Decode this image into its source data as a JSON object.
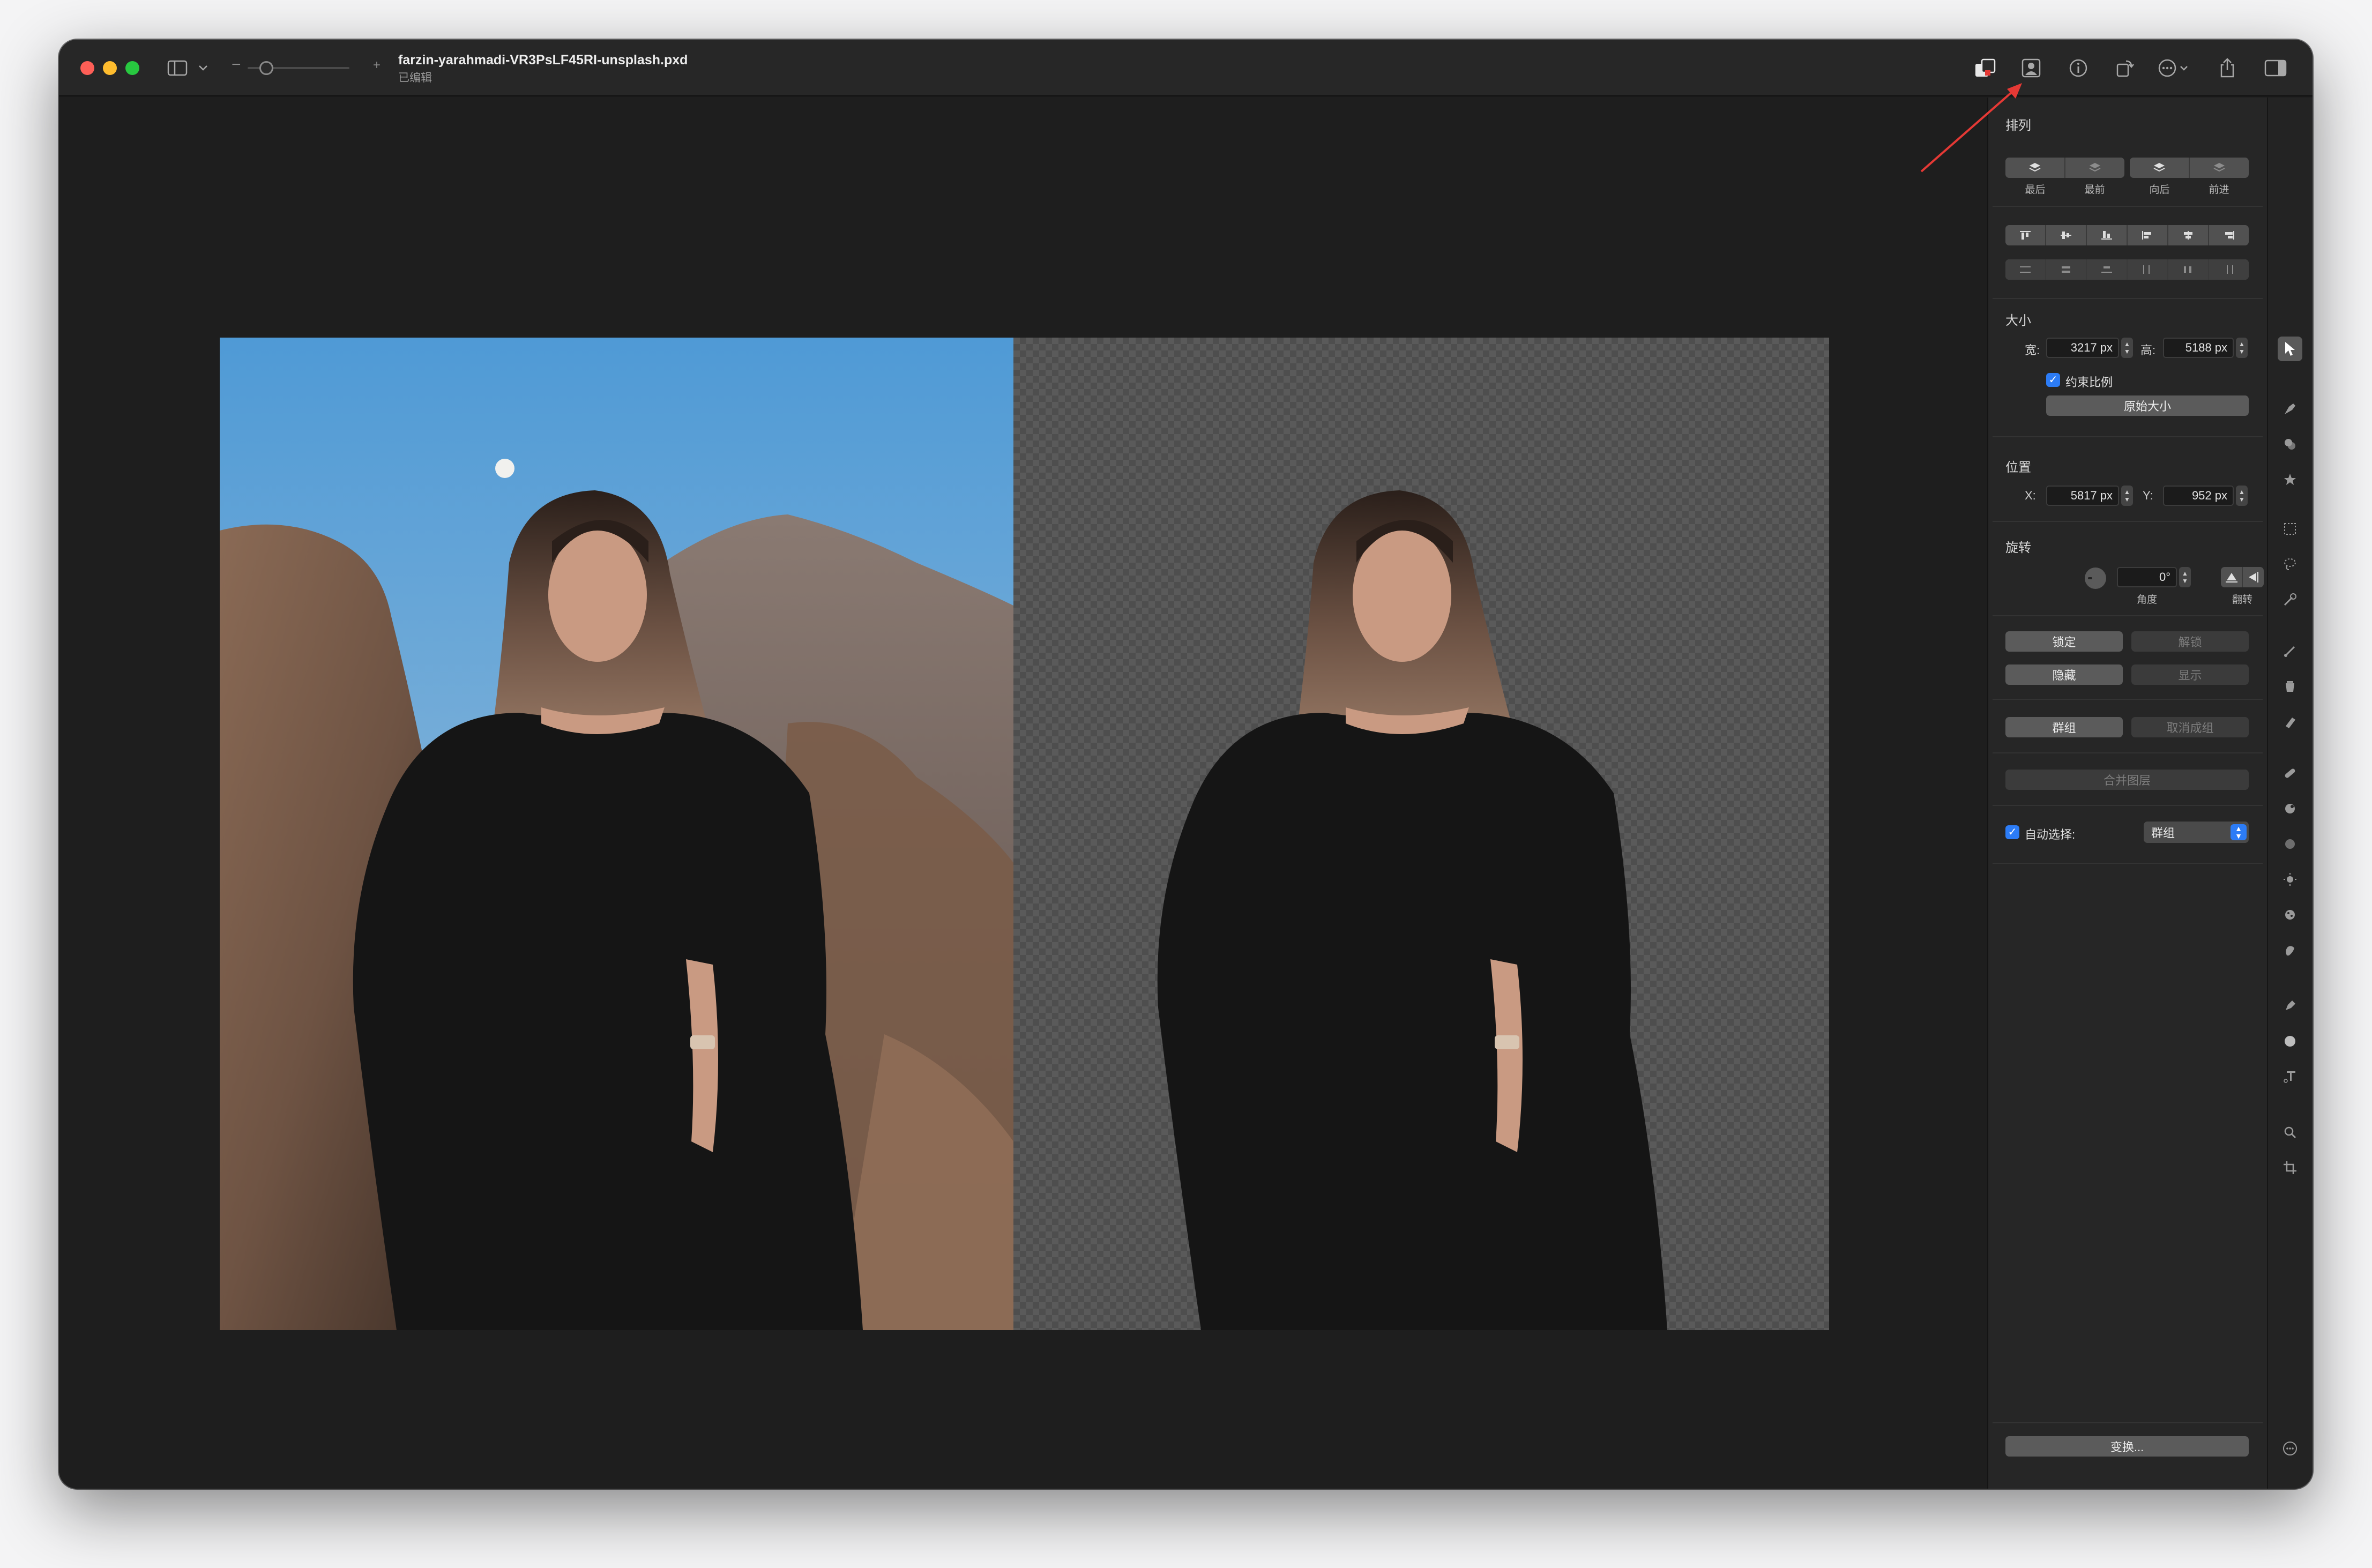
{
  "window": {
    "document_title": "farzin-yarahmadi-VR3PsLF45RI-unsplash.pxd",
    "document_status": "已编辑"
  },
  "toolbar": {
    "zoom_minus": "−",
    "zoom_plus": "+",
    "icons": [
      "sidebar-toggle-icon",
      "chevron-down-icon",
      "layer-style-icon",
      "portrait-mask-icon",
      "info-icon",
      "rotate-icon",
      "more-icon",
      "share-icon",
      "inspector-toggle-icon"
    ]
  },
  "inspector": {
    "arrange": {
      "title": "排列",
      "order_buttons": [
        "最后",
        "最前",
        "向后",
        "前进"
      ]
    },
    "size": {
      "title": "大小",
      "width_label": "宽:",
      "width_value": "3217 px",
      "height_label": "高:",
      "height_value": "5188 px",
      "constrain_label": "约束比例",
      "constrain_checked": true,
      "original_size_button": "原始大小"
    },
    "position": {
      "title": "位置",
      "x_label": "X:",
      "x_value": "5817 px",
      "y_label": "Y:",
      "y_value": "952 px"
    },
    "rotation": {
      "title": "旋转",
      "angle_value": "0°",
      "angle_label": "角度",
      "flip_label": "翻转"
    },
    "lock_button": "锁定",
    "unlock_button": "解锁",
    "hide_button": "隐藏",
    "show_button": "显示",
    "group_button": "群组",
    "ungroup_button": "取消成组",
    "merge_button": "合并图层",
    "auto_select_label": "自动选择:",
    "auto_select_checked": true,
    "auto_select_value": "群组",
    "transform_button": "变换..."
  },
  "tools": [
    "arrow-select-icon",
    "style-brush-icon",
    "color-adjust-icon",
    "effects-star-icon",
    "marquee-select-icon",
    "lasso-select-icon",
    "magic-wand-icon",
    "paint-brush-icon",
    "paint-bucket-icon",
    "eraser-icon",
    "repair-icon",
    "clone-stamp-icon",
    "blur-icon",
    "lighten-icon",
    "sponge-icon",
    "smudge-icon",
    "pen-icon",
    "shape-icon",
    "text-icon",
    "zoom-icon",
    "crop-icon",
    "more-tools-icon"
  ],
  "colors": {
    "accent": "#2c7cf6",
    "annotation": "#e53935"
  }
}
